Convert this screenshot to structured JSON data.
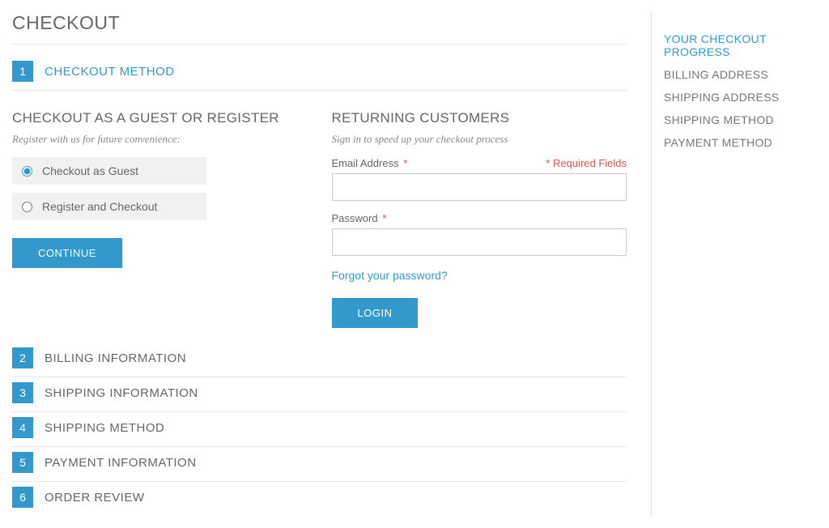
{
  "page": {
    "title": "CHECKOUT"
  },
  "steps": [
    {
      "num": "1",
      "title": "CHECKOUT METHOD"
    },
    {
      "num": "2",
      "title": "BILLING INFORMATION"
    },
    {
      "num": "3",
      "title": "SHIPPING INFORMATION"
    },
    {
      "num": "4",
      "title": "SHIPPING METHOD"
    },
    {
      "num": "5",
      "title": "PAYMENT INFORMATION"
    },
    {
      "num": "6",
      "title": "ORDER REVIEW"
    }
  ],
  "guest": {
    "heading": "CHECKOUT AS A GUEST OR REGISTER",
    "sub": "Register with us for future convenience:",
    "options": [
      "Checkout as Guest",
      "Register and Checkout"
    ],
    "continue_label": "CONTINUE"
  },
  "returning": {
    "heading": "RETURNING CUSTOMERS",
    "sub": "Sign in to speed up your checkout process",
    "email_label": "Email Address",
    "password_label": "Password",
    "required_fields": "* Required Fields",
    "forgot_label": "Forgot your password?",
    "login_label": "LOGIN"
  },
  "progress": {
    "title": "YOUR CHECKOUT PROGRESS",
    "items": [
      "BILLING ADDRESS",
      "SHIPPING ADDRESS",
      "SHIPPING METHOD",
      "PAYMENT METHOD"
    ]
  }
}
